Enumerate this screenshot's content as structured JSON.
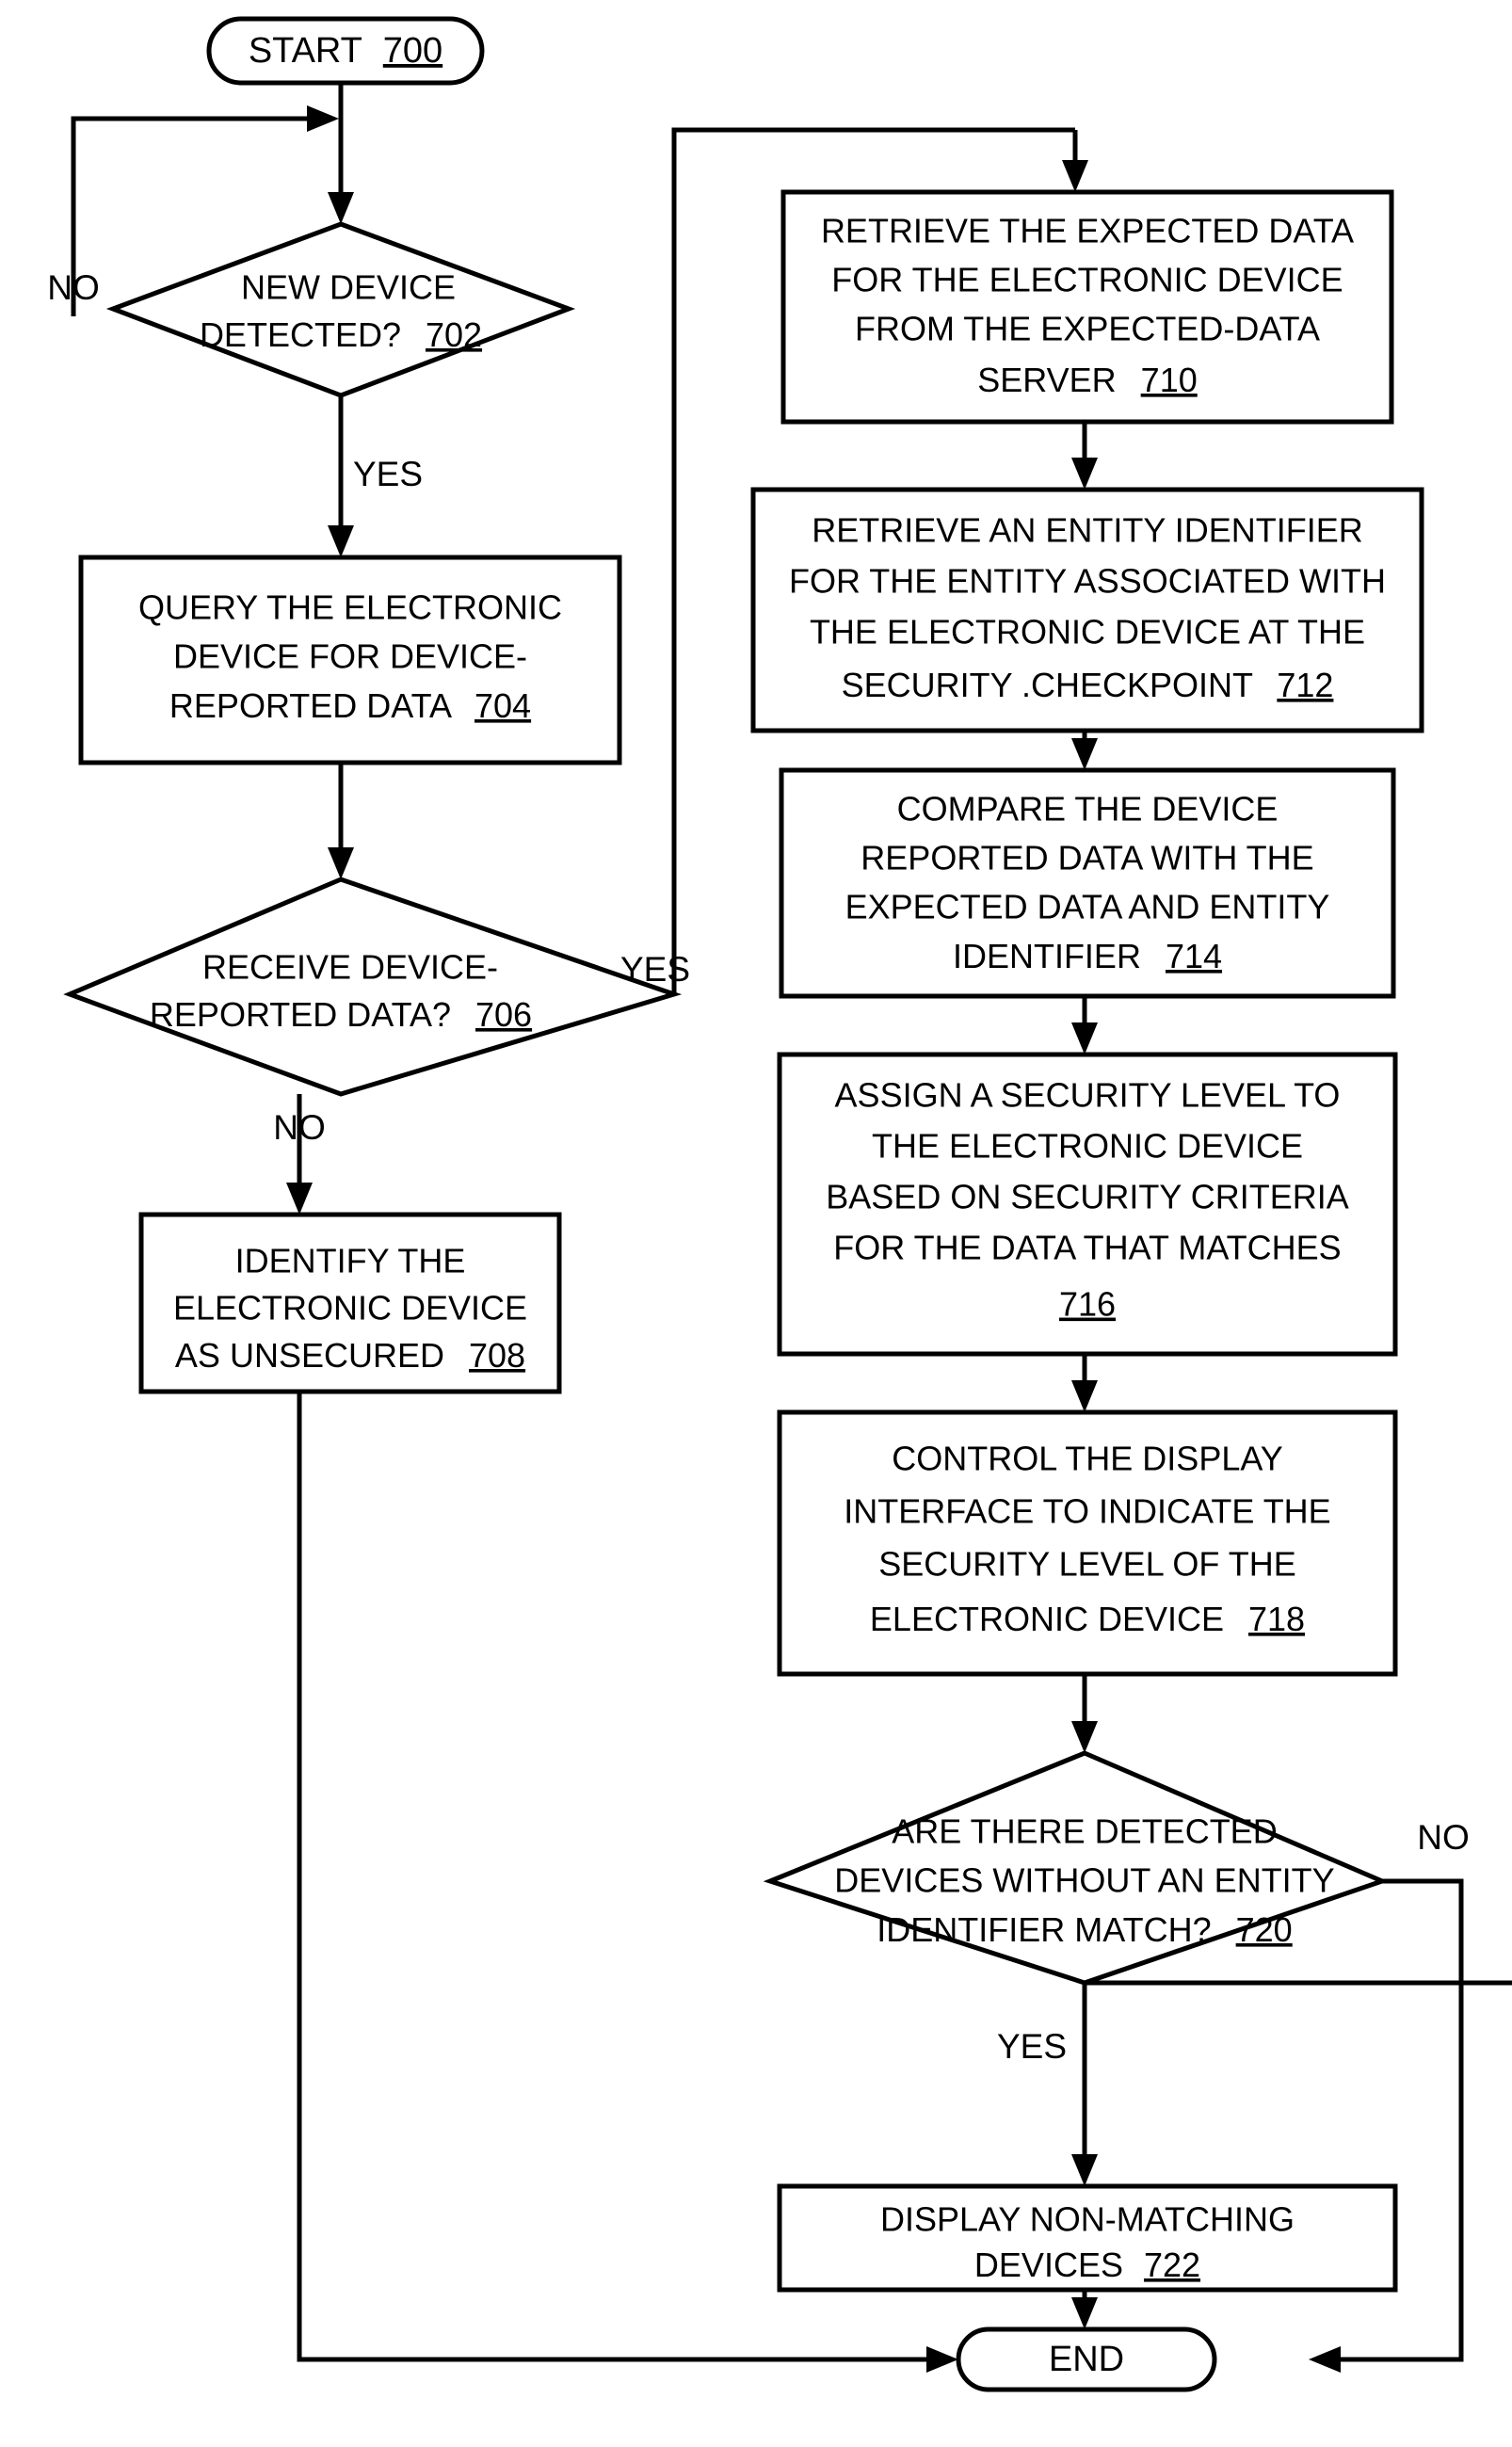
{
  "figure": {
    "title": "Security checkpoint device verification flowchart",
    "ink_color": "#000000",
    "background_color": "#ffffff"
  },
  "nodes": {
    "start": {
      "type": "terminal",
      "label": "START",
      "ref": "700"
    },
    "decision_702": {
      "type": "decision",
      "ref": "702",
      "lines": [
        "NEW DEVICE",
        "DETECTED?"
      ],
      "line1": "NEW DEVICE",
      "line2": "DETECTED?",
      "yes_label": "YES",
      "no_label": "NO"
    },
    "box_704": {
      "type": "process",
      "ref": "704",
      "line1": "QUERY THE ELECTRONIC",
      "line2": "DEVICE FOR DEVICE-",
      "line3": "REPORTED DATA"
    },
    "decision_706": {
      "type": "decision",
      "ref": "706",
      "line1": "RECEIVE DEVICE-",
      "line2": "REPORTED DATA?",
      "yes_label": "YES",
      "no_label": "NO"
    },
    "box_708": {
      "type": "process",
      "ref": "708",
      "line1": "IDENTIFY THE",
      "line2": "ELECTRONIC DEVICE",
      "line3": "AS UNSECURED"
    },
    "box_710": {
      "type": "process",
      "ref": "710",
      "line1": "RETRIEVE THE EXPECTED DATA",
      "line2": "FOR THE ELECTRONIC DEVICE",
      "line3": "FROM THE EXPECTED-DATA",
      "line4": "SERVER"
    },
    "box_712": {
      "type": "process",
      "ref": "712",
      "line1": "RETRIEVE AN ENTITY IDENTIFIER",
      "line2": "FOR THE ENTITY ASSOCIATED WITH",
      "line3": "THE ELECTRONIC DEVICE AT THE",
      "line4": "SECURITY .CHECKPOINT"
    },
    "box_714": {
      "type": "process",
      "ref": "714",
      "line1": "COMPARE THE DEVICE",
      "line2": "REPORTED DATA WITH THE",
      "line3": "EXPECTED DATA AND ENTITY",
      "line4": "IDENTIFIER"
    },
    "box_716": {
      "type": "process",
      "ref": "716",
      "line1": "ASSIGN A SECURITY LEVEL TO",
      "line2": "THE ELECTRONIC DEVICE",
      "line3": "BASED ON SECURITY CRITERIA",
      "line4": "FOR THE DATA THAT MATCHES",
      "line5": "716"
    },
    "box_718": {
      "type": "process",
      "ref": "718",
      "line1": "CONTROL THE DISPLAY",
      "line2": "INTERFACE TO INDICATE THE",
      "line3": "SECURITY LEVEL OF THE",
      "line4": "ELECTRONIC DEVICE"
    },
    "decision_720": {
      "type": "decision",
      "ref": "720",
      "line1": "ARE THERE DETECTED",
      "line2": "DEVICES WITHOUT AN ENTITY",
      "line3": "IDENTIFIER MATCH?",
      "yes_label": "YES",
      "no_label": "NO"
    },
    "box_722": {
      "type": "process",
      "ref": "722",
      "line1": "DISPLAY NON-MATCHING",
      "line2": "DEVICES"
    },
    "end": {
      "type": "terminal",
      "label": "END"
    }
  }
}
